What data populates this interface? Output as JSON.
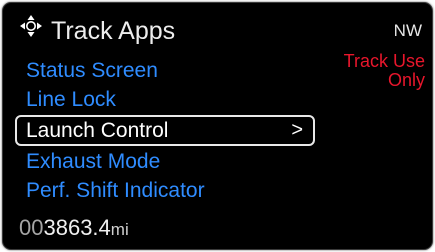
{
  "header": {
    "title": "Track Apps",
    "compass": "NW",
    "nav_icon": "four-way-arrows-icon"
  },
  "menu": {
    "items": [
      {
        "label": "Status Screen",
        "selected": false
      },
      {
        "label": "Line Lock",
        "selected": false
      },
      {
        "label": "Launch Control",
        "selected": true,
        "arrow": ">"
      },
      {
        "label": "Exhaust Mode",
        "selected": false
      },
      {
        "label": "Perf. Shift Indicator",
        "selected": false
      }
    ]
  },
  "warning": {
    "line1": "Track Use",
    "line2": "Only"
  },
  "odometer": {
    "prefix": "00",
    "value": "3863.4",
    "unit": "mi"
  },
  "colors": {
    "background": "#000000",
    "menu_text": "#2f8cff",
    "selected_text": "#ffffff",
    "warning": "#e8162c"
  }
}
